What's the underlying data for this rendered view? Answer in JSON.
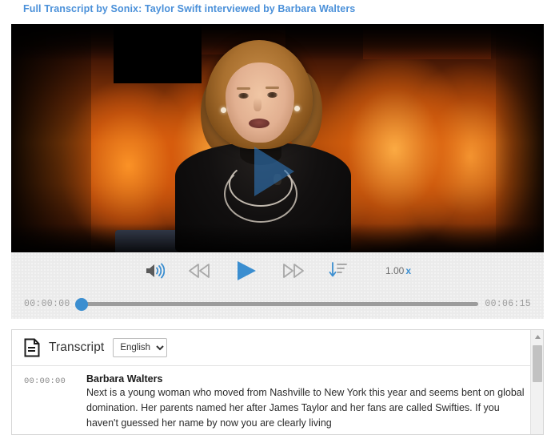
{
  "title": {
    "link_text": "Full Transcript by Sonix: Taylor Swift interviewed by Barbara Walters"
  },
  "player": {
    "play_overlay_name": "play-overlay-triangle",
    "controls": {
      "volume_label": "volume",
      "rewind_label": "rewind",
      "play_label": "play",
      "forward_label": "fast forward",
      "speed_toggle_label": "playback speed",
      "speed_value": "1.00",
      "speed_unit": "x"
    },
    "seek": {
      "current_time": "00:00:00",
      "duration": "00:06:15",
      "progress_percent": 0
    },
    "colors": {
      "accent": "#3b8ed0",
      "track": "#9c9c9c",
      "controls_bg": "#ebebeb"
    }
  },
  "transcript": {
    "heading": "Transcript",
    "language_selected": "English",
    "language_options": [
      "English"
    ],
    "segments": [
      {
        "time": "00:00:00",
        "speaker": "Barbara Walters",
        "text": "Next is a young woman who moved from Nashville to New York this year and seems bent on global domination. Her parents named her after James Taylor and her fans are called Swifties. If you haven't guessed her name by now you are clearly living"
      }
    ]
  }
}
